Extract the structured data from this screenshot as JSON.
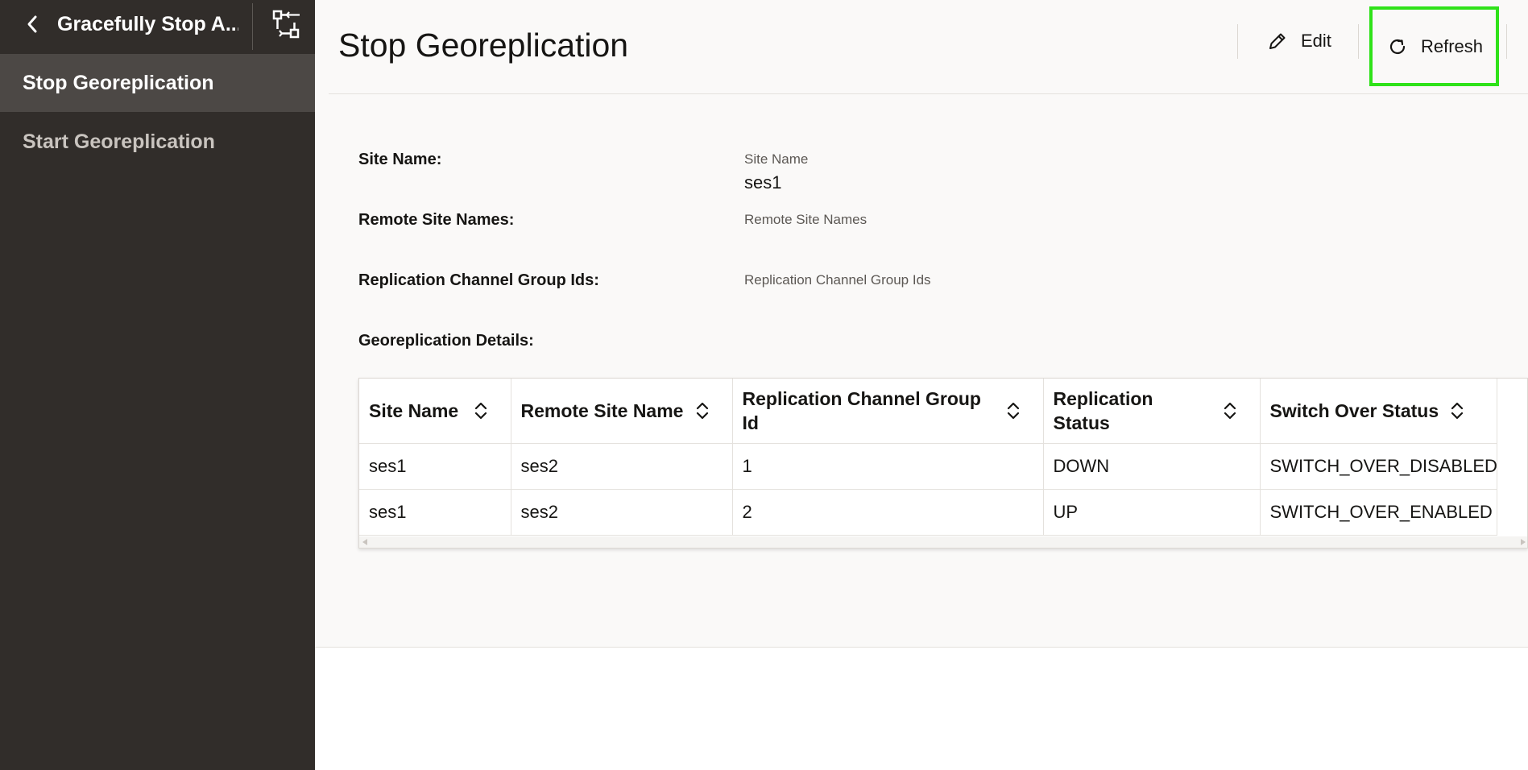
{
  "sidebar": {
    "title": "Gracefully Stop A...",
    "items": [
      {
        "label": "Stop Georeplication",
        "active": true
      },
      {
        "label": "Start Georeplication",
        "active": false
      }
    ]
  },
  "header": {
    "title": "Stop Georeplication",
    "edit_label": "Edit",
    "refresh_label": "Refresh"
  },
  "form": {
    "site_name": {
      "label": "Site Name:",
      "sub": "Site Name",
      "value": "ses1"
    },
    "remote_site_names": {
      "label": "Remote Site Names:",
      "sub": "Remote Site Names"
    },
    "replication_channel_group_ids": {
      "label": "Replication Channel Group Ids:",
      "sub": "Replication Channel Group Ids"
    },
    "georeplication_details": {
      "label": "Georeplication Details:"
    }
  },
  "table": {
    "columns": [
      "Site Name",
      "Remote Site Name",
      "Replication Channel Group Id",
      "Replication Status",
      "Switch Over Status"
    ],
    "rows": [
      [
        "ses1",
        "ses2",
        "1",
        "DOWN",
        "SWITCH_OVER_DISABLED"
      ],
      [
        "ses1",
        "ses2",
        "2",
        "UP",
        "SWITCH_OVER_ENABLED"
      ]
    ]
  },
  "colors": {
    "sidebar_bg": "#312d2a",
    "sidebar_active_bg": "#4c4845",
    "highlight": "#2fe219"
  }
}
